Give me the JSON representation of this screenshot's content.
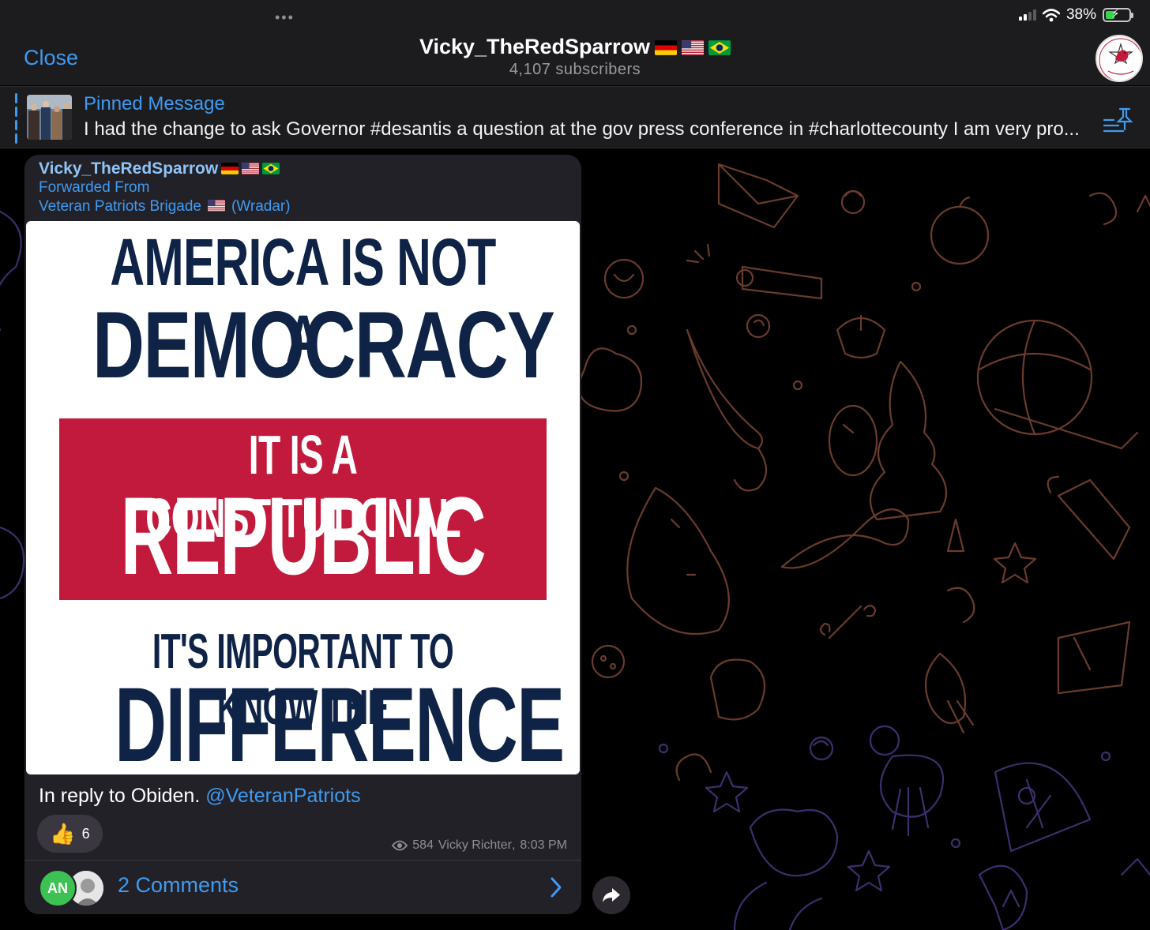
{
  "status_bar": {
    "dots": "•••",
    "battery": "38%"
  },
  "header": {
    "close_label": "Close",
    "channel_title": "Vicky_TheRedSparrow",
    "subscribers": "4,107 subscribers",
    "flags": [
      "germany-flag",
      "usa-flag",
      "brazil-flag"
    ]
  },
  "pinned": {
    "title": "Pinned Message",
    "text": "I had the change to ask Governor #desantis a question at the gov press conference in #charlottecounty I am very pro..."
  },
  "message": {
    "sender": "Vicky_TheRedSparrow",
    "forwarded_label": "Forwarded From",
    "forwarded_source": "Veteran Patriots Brigade",
    "forwarded_source_suffix": "(Wradar)",
    "poster": {
      "line1": "AMERICA IS NOT A",
      "line2": "DEMOCRACY",
      "line3": "IT IS A CONSTITUTIONAL",
      "line4": "REPUBLIC",
      "line5": "IT'S IMPORTANT TO KNOW THE",
      "line6": "DIFFERENCE"
    },
    "caption_text": "In reply to Obiden.",
    "caption_mention": "@VeteranPatriots",
    "reaction": {
      "emoji": "👍",
      "count": "6"
    },
    "meta": {
      "views": "584",
      "author": "Vicky Richter",
      "time": "8:03 PM"
    },
    "comments": {
      "avatar_initials": "AN",
      "label": "2 Comments"
    }
  },
  "colors": {
    "accent": "#3e9bf2",
    "bubble": "#232128",
    "poster_navy": "#0f2347",
    "poster_red": "#c21a3c"
  }
}
